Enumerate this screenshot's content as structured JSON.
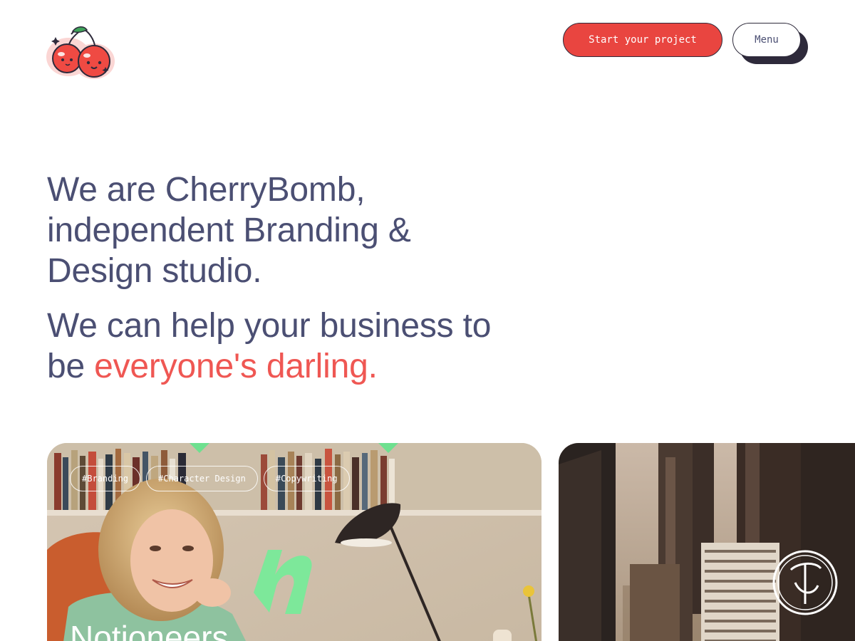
{
  "header": {
    "logo_name": "CherryBomb",
    "cta_label": "Start your project",
    "menu_label": "Menu"
  },
  "hero": {
    "line1": "We are CherryBomb, independent Branding & Design studio.",
    "line2_prefix": "We can help your business to be ",
    "line2_accent": "everyone's darling."
  },
  "cards": [
    {
      "tags": [
        "#Branding",
        "#Character Design",
        "#Copywriting"
      ],
      "title": "Notioneers"
    },
    {
      "tags": [],
      "title": ""
    }
  ],
  "colors": {
    "text": "#4b4f73",
    "accent": "#ef5753",
    "cta": "#e94540",
    "dark": "#2e2a3b"
  }
}
